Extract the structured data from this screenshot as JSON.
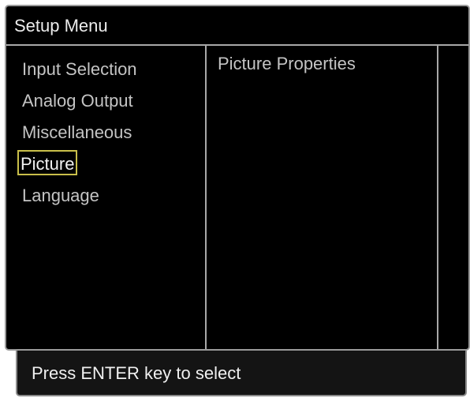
{
  "window": {
    "title": "Setup Menu"
  },
  "menu": {
    "items": [
      {
        "label": "Input Selection",
        "selected": false
      },
      {
        "label": "Analog Output",
        "selected": false
      },
      {
        "label": "Miscellaneous",
        "selected": false
      },
      {
        "label": "Picture",
        "selected": true
      },
      {
        "label": "Language",
        "selected": false
      }
    ]
  },
  "panel": {
    "heading": "Picture Properties"
  },
  "status": {
    "text": "Press ENTER key to select"
  },
  "colors": {
    "background": "#000000",
    "text": "#c4c4c4",
    "selection_border": "#c9bf4a",
    "divider": "#a8a8a8"
  }
}
